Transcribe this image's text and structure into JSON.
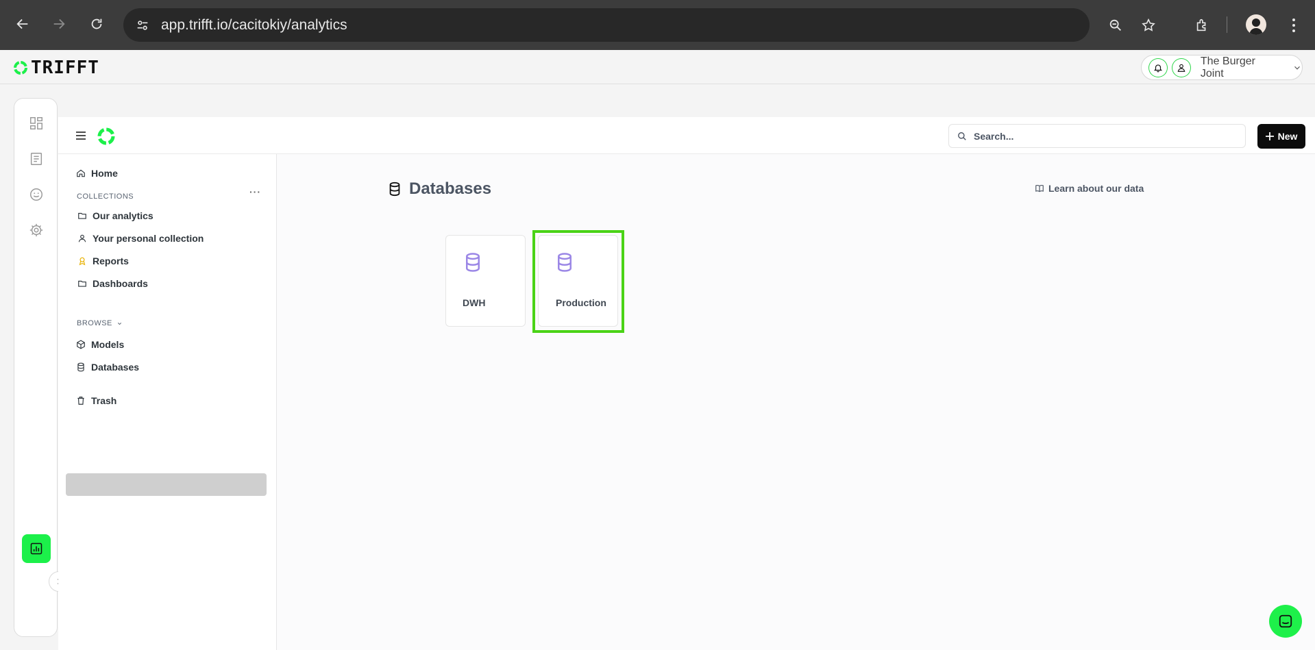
{
  "browser": {
    "url": "app.trifft.io/cacitokiy/analytics"
  },
  "app": {
    "logo_text": "TRIFFT",
    "org_name": "The Burger Joint",
    "brand_color": "#1cf04a"
  },
  "topbar": {
    "search_placeholder": "Search...",
    "new_label": "New"
  },
  "sidebar": {
    "home": "Home",
    "collections_heading": "COLLECTIONS",
    "collections": [
      {
        "label": "Our analytics",
        "icon": "folder-icon"
      },
      {
        "label": "Your personal collection",
        "icon": "person-icon"
      },
      {
        "label": "Reports",
        "icon": "badge-icon"
      },
      {
        "label": "Dashboards",
        "icon": "folder-icon"
      }
    ],
    "browse_heading": "BROWSE",
    "browse": [
      {
        "label": "Models",
        "icon": "cube-icon"
      },
      {
        "label": "Databases",
        "icon": "database-icon",
        "active": true
      }
    ],
    "trash": "Trash"
  },
  "main": {
    "title": "Databases",
    "learn_link": "Learn about our data",
    "databases": [
      {
        "name": "DWH"
      },
      {
        "name": "Production",
        "highlighted": true
      }
    ]
  }
}
